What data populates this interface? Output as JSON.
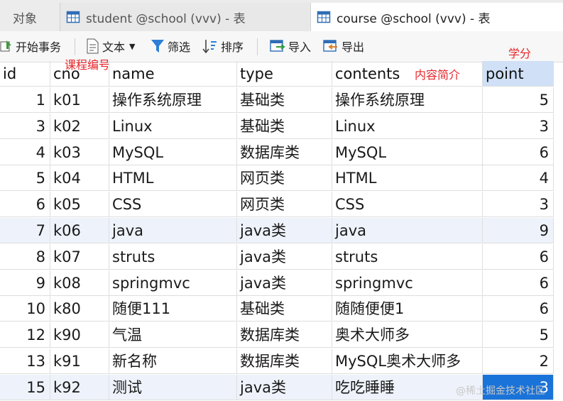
{
  "tabs": [
    {
      "label": "对象"
    },
    {
      "label": "student @school (vvv) - 表"
    },
    {
      "label": "course @school (vvv) - 表"
    }
  ],
  "toolbar": {
    "begin_transaction": "开始事务",
    "text": "文本",
    "filter": "筛选",
    "sort": "排序",
    "import": "导入",
    "export": "导出"
  },
  "annotations": {
    "cno": "课程编号",
    "contents": "内容简介",
    "point": "学分"
  },
  "columns": [
    "id",
    "cno",
    "name",
    "type",
    "contents",
    "point"
  ],
  "rows": [
    [
      "1",
      "k01",
      "操作系统原理",
      "基础类",
      "操作系统原理",
      "5"
    ],
    [
      "3",
      "k02",
      "Linux",
      "基础类",
      "Linux",
      "3"
    ],
    [
      "4",
      "k03",
      "MySQL",
      "数据库类",
      "MySQL",
      "6"
    ],
    [
      "5",
      "k04",
      "HTML",
      "网页类",
      "HTML",
      "4"
    ],
    [
      "6",
      "k05",
      "CSS",
      "网页类",
      "CSS",
      "3"
    ],
    [
      "7",
      "k06",
      "java",
      "java类",
      "java",
      "9"
    ],
    [
      "8",
      "k07",
      "struts",
      "java类",
      "struts",
      "6"
    ],
    [
      "9",
      "k08",
      "springmvc",
      "java类",
      "springmvc",
      "6"
    ],
    [
      "10",
      "k80",
      "随便111",
      "基础类",
      "随随便便1",
      "6"
    ],
    [
      "12",
      "k90",
      "气温",
      "数据库类",
      "奥术大师多",
      "5"
    ],
    [
      "13",
      "k91",
      "新名称",
      "数据库类",
      "MySQL奥术大师多",
      "2"
    ],
    [
      "15",
      "k92",
      "测试",
      "java类",
      "吃吃睡睡",
      "3"
    ]
  ],
  "watermark": "@稀土掘金技术社区",
  "colors": {
    "selection": "#1a73d9",
    "annotation": "#e8262a",
    "row_alt": "#eef3fb"
  }
}
